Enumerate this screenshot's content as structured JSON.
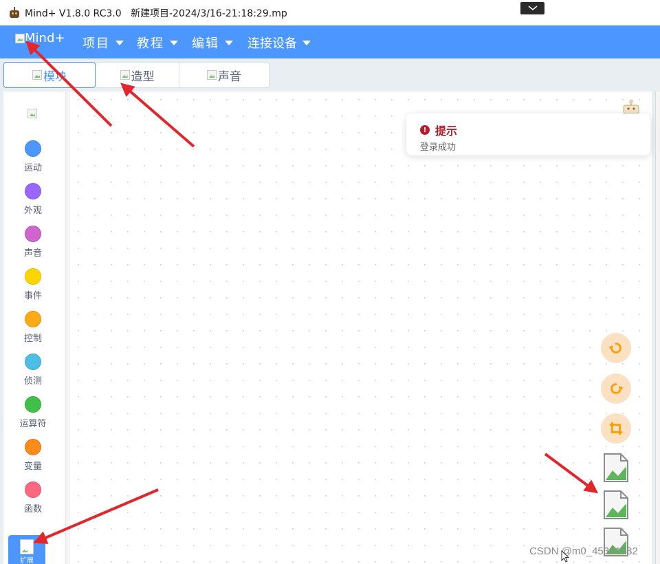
{
  "window": {
    "title": "Mind+ V1.8.0 RC3.0   新建项目-2024/3/16-21:18:29.mp"
  },
  "menubar": {
    "logo_text": "Mind+",
    "items": [
      {
        "label": "项目"
      },
      {
        "label": "教程"
      },
      {
        "label": "编辑"
      },
      {
        "label": "连接设备"
      }
    ]
  },
  "tabs": [
    {
      "label": "模块",
      "active": true
    },
    {
      "label": "造型",
      "active": false
    },
    {
      "label": "声音",
      "active": false
    }
  ],
  "categories": [
    {
      "label": "运动",
      "color": "#4c97ff"
    },
    {
      "label": "外观",
      "color": "#9966ff"
    },
    {
      "label": "声音",
      "color": "#cf63cf"
    },
    {
      "label": "事件",
      "color": "#ffd500"
    },
    {
      "label": "控制",
      "color": "#ffab19"
    },
    {
      "label": "侦测",
      "color": "#4cbfe6"
    },
    {
      "label": "运算符",
      "color": "#40bf4a"
    },
    {
      "label": "变量",
      "color": "#ff8c1a"
    },
    {
      "label": "函数",
      "color": "#ff6680"
    }
  ],
  "extension": {
    "label": "扩展"
  },
  "toast": {
    "title": "提示",
    "message": "登录成功",
    "icon": "exclamation-circle-icon"
  },
  "zoom_controls": {
    "icons": [
      "undo-icon",
      "redo-icon",
      "crop-icon"
    ],
    "color": "#ff9c00"
  },
  "watermark": {
    "text": "CSDN @m0_45361932"
  },
  "colors": {
    "menubar": "#4c97ff",
    "annotation_arrow": "#e3262b"
  }
}
